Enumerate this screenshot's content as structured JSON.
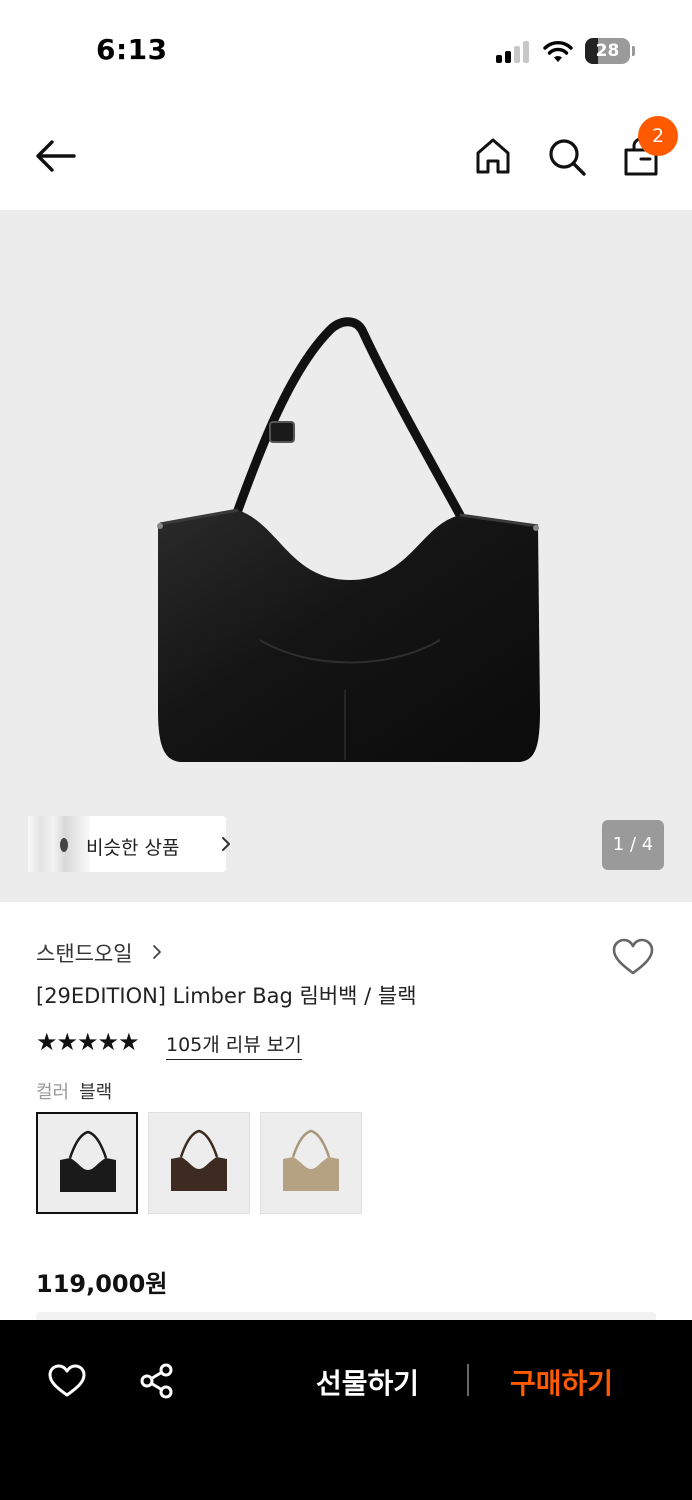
{
  "status_bar": {
    "time": "6:13",
    "battery_level": "28"
  },
  "nav": {
    "back_icon": "arrow-left-icon",
    "home_icon": "home-icon",
    "search_icon": "search-icon",
    "cart_icon": "shopping-bag-icon",
    "cart_badge_count": "2"
  },
  "gallery": {
    "similar_label": "비슷한 상품",
    "pager": "1 / 4"
  },
  "product": {
    "brand": "스탠드오일",
    "title": "[29EDITION] Limber Bag 림버백 / 블랙",
    "rating_stars": "★★★★★",
    "rating_value": 5,
    "review_link": "105개 리뷰 보기",
    "color_key": "컬러",
    "color_value": "블랙",
    "color_options": [
      {
        "color": "#1a1a1a",
        "selected": true
      },
      {
        "color": "#3d2b22",
        "selected": false
      },
      {
        "color": "#b5a283",
        "selected": false
      }
    ],
    "price": "119,000원"
  },
  "bottom_bar": {
    "like_icon": "heart-icon",
    "share_icon": "share-icon",
    "gift_label": "선물하기",
    "buy_label": "구매하기"
  },
  "colors": {
    "accent": "#ff5a00",
    "bottom_bar_bg": "#000000",
    "hero_bg": "#ececec"
  }
}
